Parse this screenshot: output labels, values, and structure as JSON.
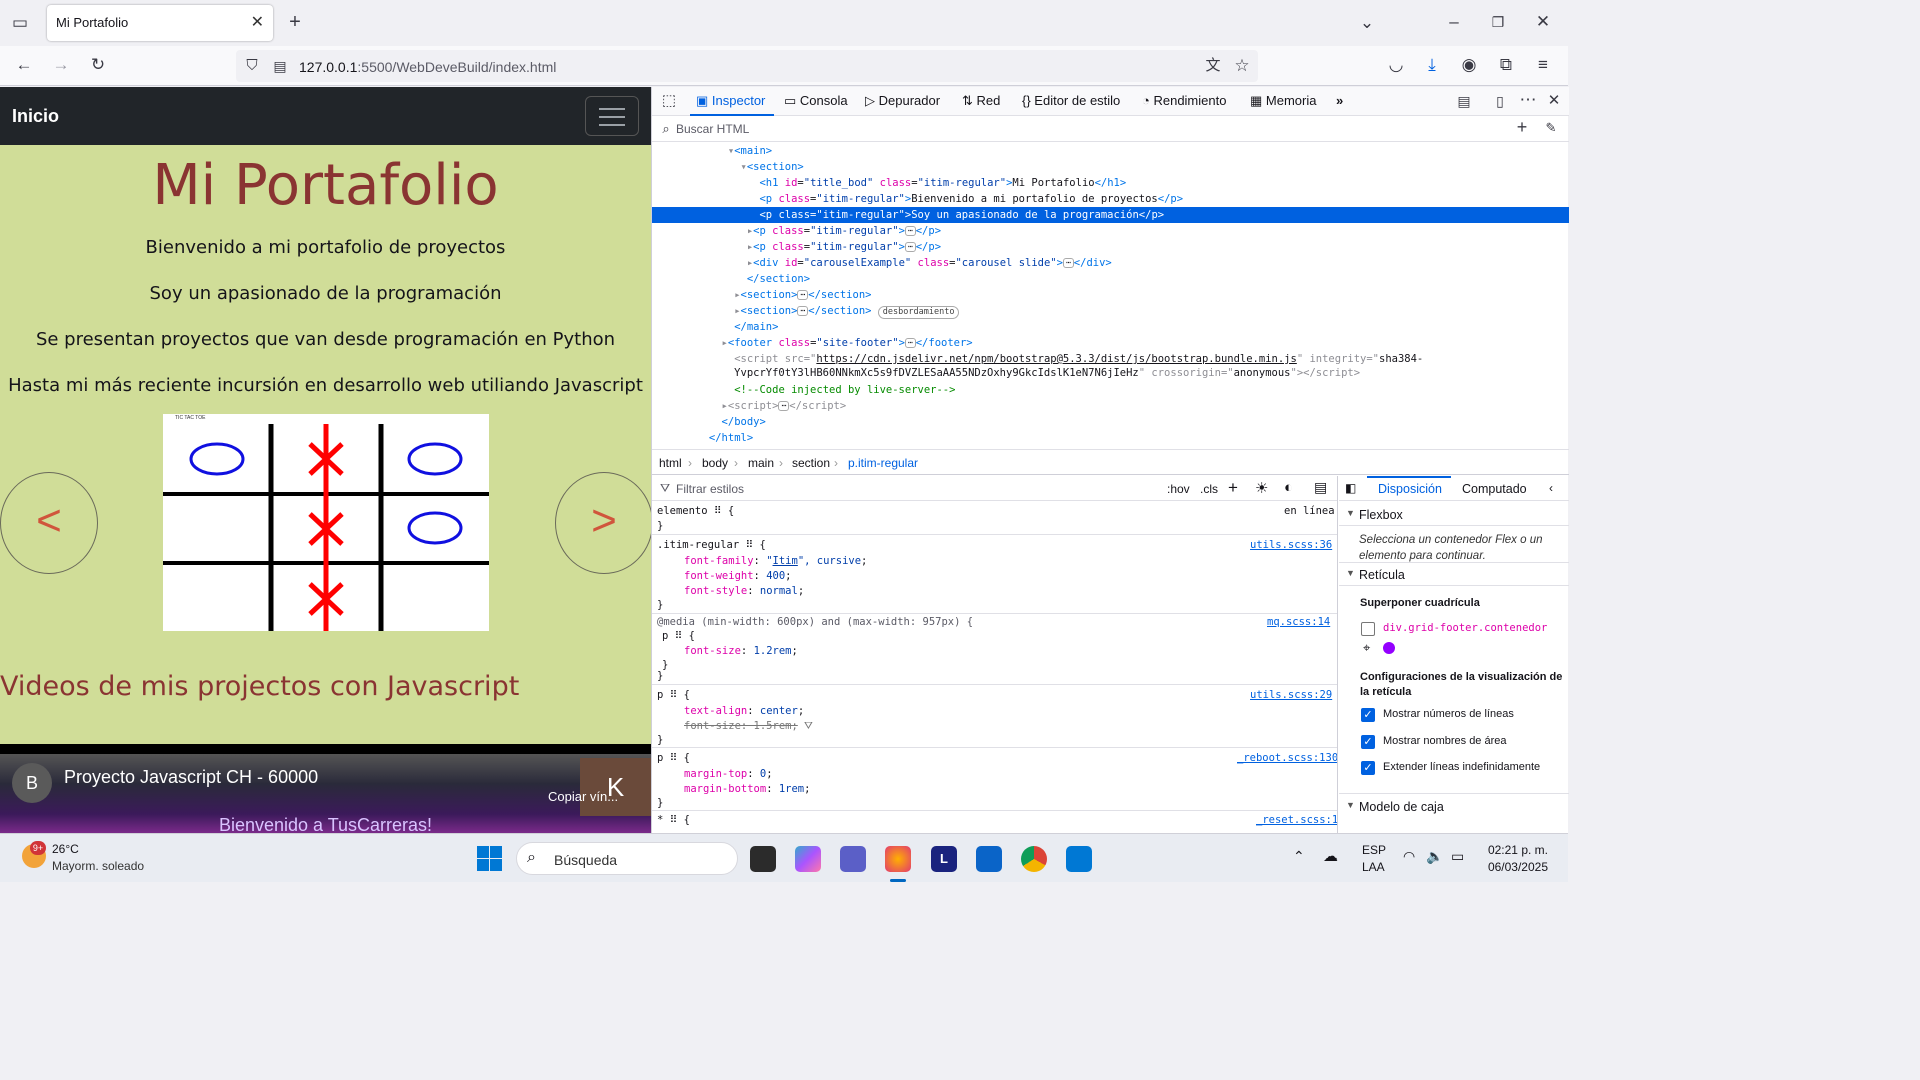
{
  "browser": {
    "tab_title": "Mi Portafolio",
    "url_host": "127.0.0.1",
    "url_rest": ":5500/WebDeveBuild/index.html"
  },
  "page": {
    "nav_brand": "Inicio",
    "title": "Mi Portafolio",
    "paragraphs": [
      "Bienvenido a mi portafolio de proyectos",
      "Soy un apasionado de la programación",
      "Se presentan proyectos que van desde programación en Python",
      "Hasta mi más reciente incursión en desarrollo web utiliando Javascript"
    ],
    "carousel_prev": "<",
    "carousel_next": ">",
    "game_window_title": "TIC TAC TOE",
    "videos_heading": "Videos de mis projectos con Javascript",
    "video": {
      "avatar_letter": "B",
      "title": "Proyecto Javascript CH - 60000",
      "copy_label": "Copiar vín...",
      "channel_letter": "K",
      "banner": "Bienvenido a TusCarreras!"
    }
  },
  "devtools": {
    "tabs": [
      "Inspector",
      "Consola",
      "Depurador",
      "Red",
      "Editor de estilo",
      "Rendimiento",
      "Memoria"
    ],
    "search_placeholder": "Buscar HTML",
    "breadcrumbs": [
      "html",
      "body",
      "main",
      "section",
      "p.itim-regular"
    ],
    "filter_placeholder": "Filtrar estilos",
    "hov": ":hov",
    "cls": ".cls",
    "layout_tabs": [
      "Disposición",
      "Computado"
    ],
    "overflow_badge": "desbordamiento",
    "element_rule": "elemento",
    "inline_label": "en línea",
    "sources": [
      "utils.scss:36",
      "mq.scss:14",
      "utils.scss:29",
      "_reboot.scss:130",
      "_reset.scss:1"
    ],
    "layout": {
      "flexbox_header": "Flexbox",
      "flexbox_msg": "Selecciona un contenedor Flex o un elemento para continuar.",
      "grid_header": "Retícula",
      "overlay_label": "Superponer cuadrícula",
      "grid_item": "div.grid-footer.contenedor",
      "settings_label": "Configuraciones de la visualización de la retícula",
      "options": [
        "Mostrar números de líneas",
        "Mostrar nombres de área",
        "Extender líneas indefinidamente"
      ],
      "boxmodel_header": "Modelo de caja"
    }
  },
  "taskbar": {
    "temp": "26°C",
    "weather": "Mayorm. soleado",
    "weather_badge": "9+",
    "search": "Búsqueda",
    "lang1": "ESP",
    "lang2": "LAA",
    "time": "02:21 p. m.",
    "date": "06/03/2025"
  },
  "colors": {
    "accent": "#0061e0",
    "page_bg": "#d0dd98",
    "title": "#8a3432"
  }
}
